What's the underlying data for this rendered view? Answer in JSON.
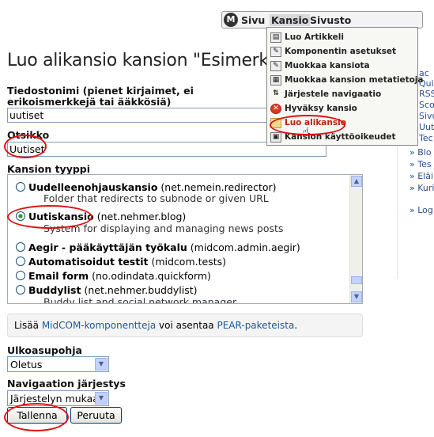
{
  "page": {
    "title": "Luo alikansio kansion \"Esimerkki\""
  },
  "form": {
    "tiedostonimi_label": "Tiedostonimi (pienet kirjaimet, ei erikoismerkkejä tai ääkkösiä)",
    "tiedostonimi_value": "uutiset",
    "otsikko_label": "Otsikko",
    "otsikko_value": "Uutiset",
    "tyyppi_label": "Kansion tyyppi",
    "types": [
      {
        "name": "Uudelleenohjauskansio",
        "component": "(net.nemein.redirector)",
        "desc": "Folder that redirects to subnode or given URL"
      },
      {
        "name": "Uutiskansio",
        "component": "(net.nehmer.blog)",
        "desc": "System for displaying and managing news posts"
      },
      {
        "name": "Aegir - pääkäyttäjän työkalu",
        "component": "(midcom.admin.aegir)",
        "desc": ""
      },
      {
        "name": "Automatisoidut testit",
        "component": "(midcom.tests)",
        "desc": ""
      },
      {
        "name": "Email form",
        "component": "(no.odindata.quickform)",
        "desc": ""
      },
      {
        "name": "Buddylist",
        "component": "(net.nehmer.buddylist)",
        "desc": "Buddy list and social network manager"
      }
    ],
    "notice_pre": "Lisää",
    "notice_link1": "MidCOM-komponentteja",
    "notice_mid": "voi asentaa",
    "notice_link2": "PEAR-paketeista",
    "notice_post": ".",
    "ulkoasu_label": "Ulkoasupohja",
    "ulkoasu_value": "Oletus",
    "nav_label": "Navigaation järjestys",
    "nav_value": "Järjestelyn mukaan",
    "save_label": "Tallenna",
    "cancel_label": "Peruuta"
  },
  "menubar": {
    "logo": "M",
    "items": [
      "Sivu",
      "Kansio",
      "Sivusto"
    ]
  },
  "dropdown": {
    "items": [
      "Luo Artikkeli",
      "Komponentin asetukset",
      "Muokkaa kansiota",
      "Muokkaa kansion metatietoja",
      "Järjestele navigaatio",
      "Hyväksy kansio",
      "Luo alikansio",
      "Kansion käyttöoikeudet"
    ]
  },
  "sidebar": {
    "fragments": [
      "ac",
      "Qui",
      "RSS",
      "Sco",
      "Sivu",
      "Uut",
      "Tec",
      "Blo",
      "Tes",
      "Eläi",
      "Kuri",
      "Log"
    ]
  },
  "colors": {
    "accent": "#2a4f8f",
    "highlight": "#e01010",
    "link": "#1a5a9a"
  }
}
